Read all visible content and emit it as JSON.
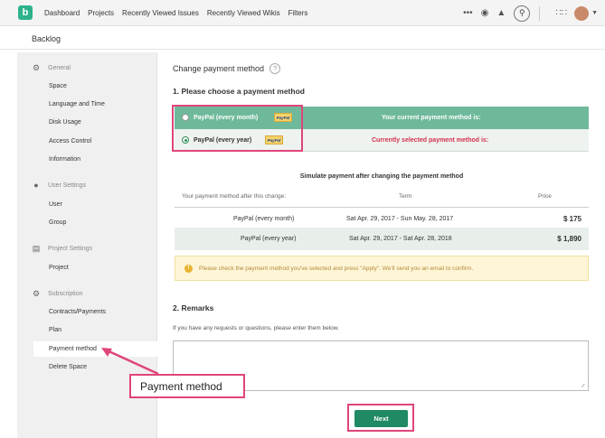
{
  "nav": {
    "links": [
      "Dashboard",
      "Projects",
      "Recently Viewed Issues",
      "Recently Viewed Wikis",
      "Filters"
    ],
    "icons": [
      "more-icon",
      "watch-icon",
      "bell-icon",
      "search-icon",
      "apps-icon",
      "avatar"
    ],
    "logo_letter": "b",
    "brand_color": "#2eb28c"
  },
  "project": {
    "title": "Backlog"
  },
  "sidebar": {
    "sections": [
      {
        "label": "General",
        "icon": "gear-icon",
        "items": [
          "Space",
          "Language and Time",
          "Disk Usage",
          "Access Control",
          "Information"
        ]
      },
      {
        "label": "User Settings",
        "icon": "user-icon",
        "items": [
          "User",
          "Group"
        ]
      },
      {
        "label": "Project Settings",
        "icon": "folder-icon",
        "items": [
          "Project"
        ]
      },
      {
        "label": "Subscription",
        "icon": "subscription-icon",
        "items": [
          "Contracts/Payments",
          "Plan",
          "Payment method",
          "Delete Space"
        ]
      }
    ],
    "active_item": "Payment method"
  },
  "main": {
    "title": "Change payment method",
    "help": "?",
    "section1": "1. Please choose a payment method",
    "methods": [
      {
        "label": "PayPal (every month)",
        "selected": false,
        "status": "Your current payment method is:"
      },
      {
        "label": "PayPal (every year)",
        "selected": true,
        "status": "Currently selected payment method is:"
      }
    ],
    "paypal_badge": "PayPal",
    "simulate": {
      "title": "Simulate payment after changing the payment method",
      "headers": [
        "Your payment method after this change:",
        "Term",
        "Price"
      ],
      "rows": [
        {
          "method": "PayPal (every month)",
          "term": "Sat Apr. 29, 2017 - Sun May. 28, 2017",
          "price": "$ 175"
        },
        {
          "method": "PayPal (every year)",
          "term": "Sat Apr. 29, 2017 - Sat Apr. 28, 2018",
          "price": "$ 1,890"
        }
      ]
    },
    "notice": "Please check the payment method you've selected and press \"Apply\". We'll send you an email to confirm.",
    "section2": "2. Remarks",
    "remarks_hint": "If you have any requests or questions, please enter them below.",
    "remarks_value": "",
    "next_label": "Next"
  },
  "callout": {
    "text": "Payment method"
  },
  "colors": {
    "selected_row": "#6fb99b",
    "warning_text": "#d5304f",
    "next_button": "#1f8a63",
    "highlight": "#e0457b"
  }
}
